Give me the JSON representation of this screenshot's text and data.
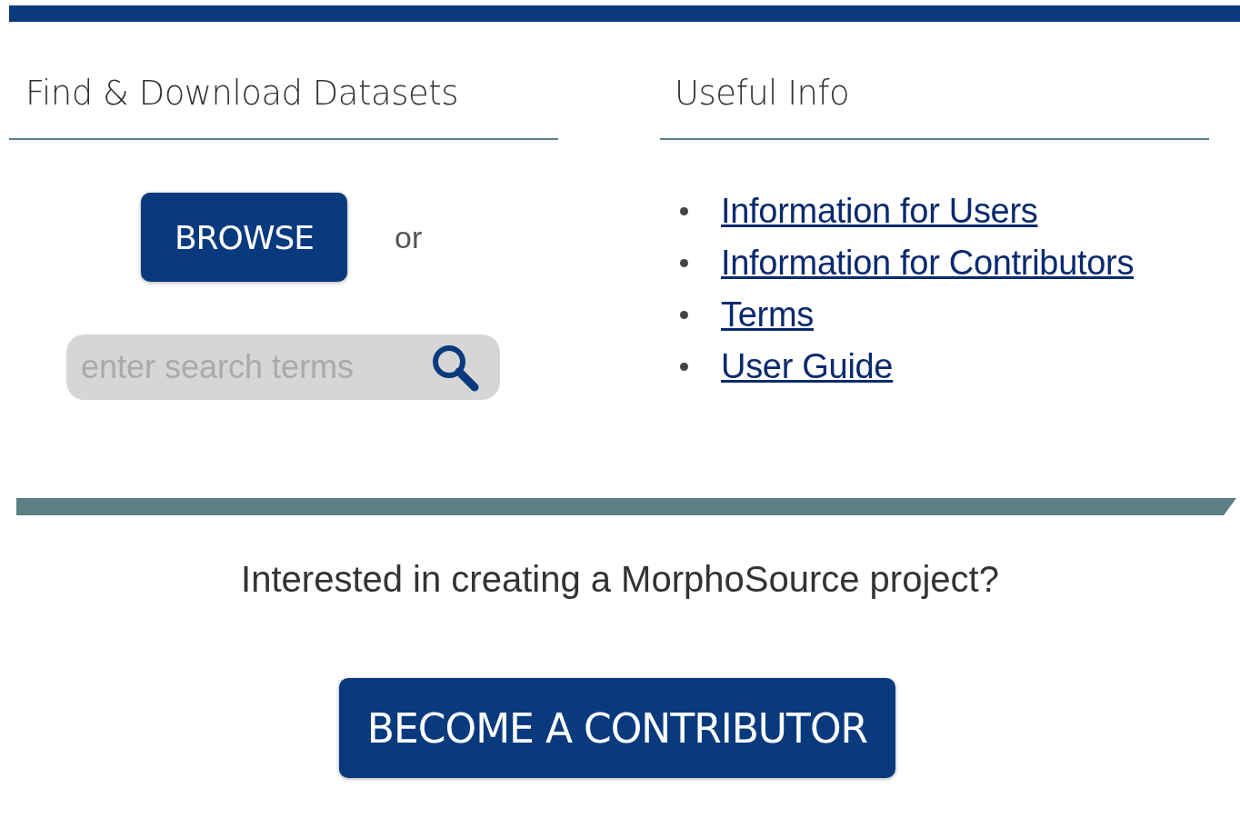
{
  "find_section": {
    "heading": "Find & Download Datasets",
    "browse_button": "BROWSE",
    "or_text": "or",
    "search": {
      "placeholder": "enter search terms"
    }
  },
  "info_section": {
    "heading": "Useful Info",
    "links": [
      {
        "label": "Information for Users"
      },
      {
        "label": "Information for Contributors"
      },
      {
        "label": "Terms"
      },
      {
        "label": "User Guide"
      }
    ]
  },
  "contributor_section": {
    "prompt": "Interested in creating a MorphoSource project?",
    "button": "BECOME A CONTRIBUTOR"
  }
}
